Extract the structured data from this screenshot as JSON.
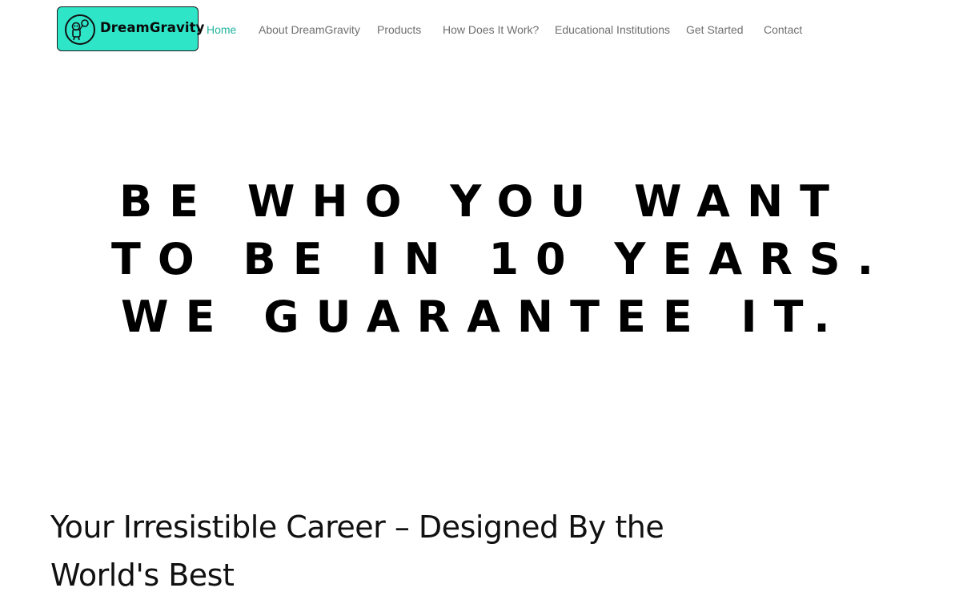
{
  "logo": {
    "text": "DreamGravity",
    "icon": "astronaut-logo-icon",
    "background": "#2ee5c8"
  },
  "nav": {
    "items": [
      {
        "label": "Home",
        "active": true
      },
      {
        "label": "About DreamGravity",
        "active": false
      },
      {
        "label": "Products",
        "active": false
      },
      {
        "label": "How Does It Work?",
        "active": false
      },
      {
        "label": "Educational Institutions",
        "active": false
      },
      {
        "label": "Get Started",
        "active": false
      },
      {
        "label": "Contact",
        "active": false
      }
    ],
    "active_color": "#22b5a0",
    "inactive_color": "#6f6f6f"
  },
  "hero": {
    "lines": [
      "BE WHO YOU WANT",
      "TO BE IN 10 YEARS.",
      "WE GUARANTEE IT."
    ]
  },
  "section": {
    "heading_line1": "Your Irresistible Career – Designed By the",
    "heading_line2": "World's Best"
  }
}
